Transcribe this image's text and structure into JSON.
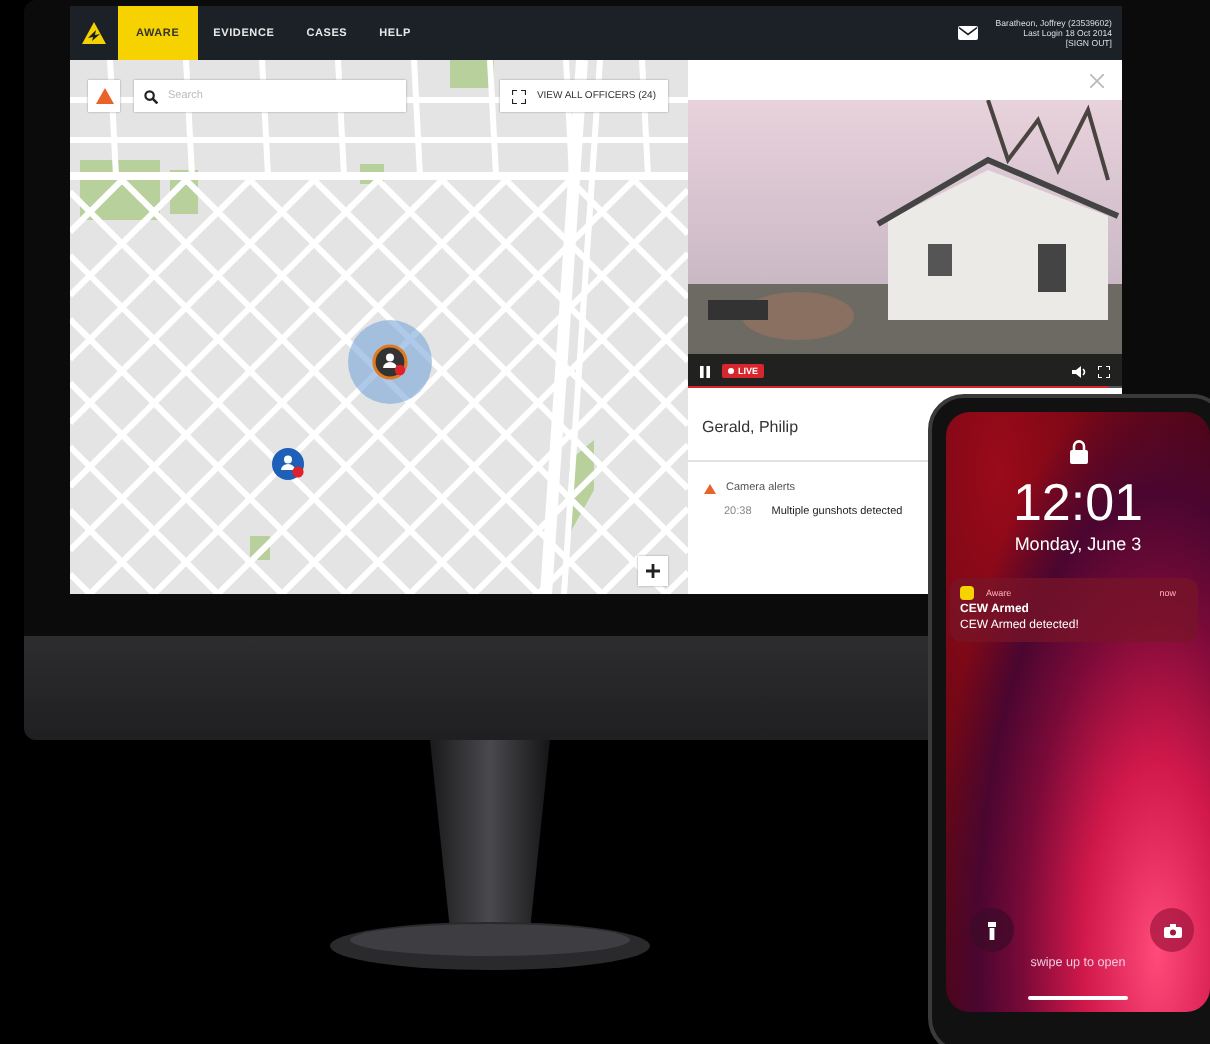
{
  "nav": {
    "tabs": [
      {
        "label": "AWARE",
        "selected": true
      },
      {
        "label": "EVIDENCE",
        "selected": false
      },
      {
        "label": "CASES",
        "selected": false
      },
      {
        "label": "HELP",
        "selected": false
      }
    ],
    "user": {
      "name": "Baratheon, Joffrey (23539602)",
      "last_login": "Last Login 18 Oct 2014",
      "sign_out": "[SIGN OUT]"
    }
  },
  "map": {
    "search": {
      "placeholder": "Search"
    },
    "view_all": "VIEW ALL OFFICERS (24)"
  },
  "video": {
    "live": "LIVE",
    "progress": {
      "level": 0.97
    }
  },
  "officer": {
    "name": "Gerald, Philip"
  },
  "alerts": [
    {
      "title": "Camera alerts",
      "time": "20:38",
      "message": "Multiple gunshots detected"
    }
  ],
  "phone": {
    "time": "12:01",
    "date": "Monday, June 3",
    "notification": {
      "app": "Aware",
      "when": "now",
      "title": "CEW Armed",
      "body": "CEW Armed detected!"
    },
    "hint": "swipe up to open"
  }
}
